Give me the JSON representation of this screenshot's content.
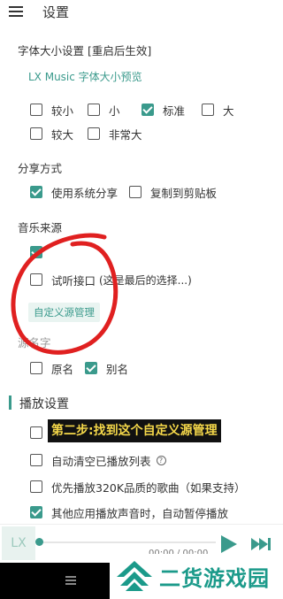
{
  "header": {
    "title": "设置"
  },
  "font_size": {
    "title": "字体大小设置 [重启后生效]",
    "preview": "LX Music 字体大小预览",
    "options": [
      {
        "label": "较小",
        "checked": false
      },
      {
        "label": "小",
        "checked": false
      },
      {
        "label": "标准",
        "checked": true
      },
      {
        "label": "大",
        "checked": false
      },
      {
        "label": "较大",
        "checked": false
      },
      {
        "label": "非常大",
        "checked": false
      }
    ]
  },
  "share": {
    "title": "分享方式",
    "options": [
      {
        "label": "使用系统分享",
        "checked": true
      },
      {
        "label": "复制到剪贴板",
        "checked": false
      }
    ]
  },
  "music_source": {
    "title": "音乐来源",
    "options": [
      {
        "label": "",
        "checked": true
      },
      {
        "label": "试听接口",
        "checked": false
      }
    ],
    "partial_text": "(这是最后的选择...)",
    "custom_button": "自定义源管理",
    "name_title_partial": "源名字",
    "name_options": [
      {
        "label": "原名",
        "checked": false
      },
      {
        "label": "别名",
        "checked": true
      }
    ]
  },
  "play": {
    "title": "播放设置",
    "options": [
      {
        "label": "",
        "checked": false
      },
      {
        "label": "自动清空已播放列表",
        "checked": false
      },
      {
        "label": "优先播放320K品质的歌曲（如果支持）",
        "checked": false
      },
      {
        "label": "其他应用播放声音时，自动暂停播放",
        "checked": true
      }
    ],
    "info_icon": "info-icon"
  },
  "caption": "第二步:找到这个自定义源管理",
  "player": {
    "art": "LX",
    "time": "00:00 / 00:00"
  },
  "watermark": {
    "text": "二货游戏园"
  },
  "colors": {
    "accent": "#3a9a8c",
    "annotation": "#e02020",
    "caption_text": "#f5d84a"
  }
}
